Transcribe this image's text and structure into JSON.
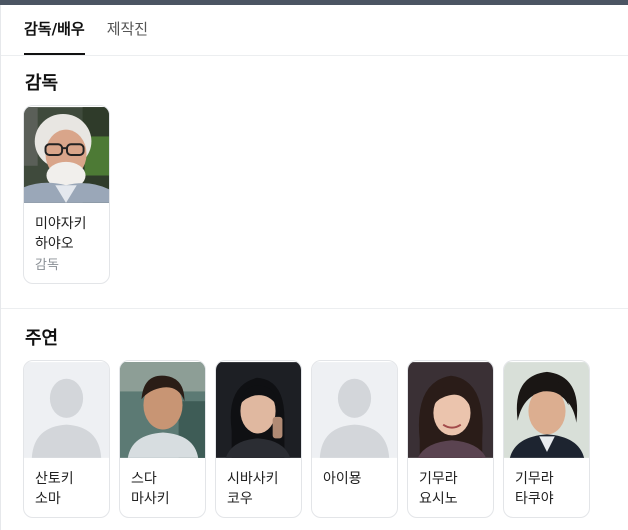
{
  "tabs": [
    {
      "label": "감독/배우",
      "active": true
    },
    {
      "label": "제작진",
      "active": false
    }
  ],
  "sections": {
    "director": {
      "title": "감독",
      "people": [
        {
          "name": "미야자키 하야오",
          "role": "감독",
          "photo": "person-photo"
        }
      ]
    },
    "cast": {
      "title": "주연",
      "people": [
        {
          "name": "산토키 소마",
          "photo": "placeholder-silhouette"
        },
        {
          "name": "스다 마사키",
          "photo": "person-photo"
        },
        {
          "name": "시바사키 코우",
          "photo": "person-photo"
        },
        {
          "name": "아이묭",
          "photo": "placeholder-silhouette"
        },
        {
          "name": "기무라 요시노",
          "photo": "person-photo"
        },
        {
          "name": "기무라 타쿠야",
          "photo": "person-photo"
        }
      ]
    }
  },
  "colors": {
    "topbar": "#4b5563",
    "active_tab": "#111111",
    "placeholder_bg": "#eef0f3",
    "placeholder_figure": "#d3d6da"
  }
}
